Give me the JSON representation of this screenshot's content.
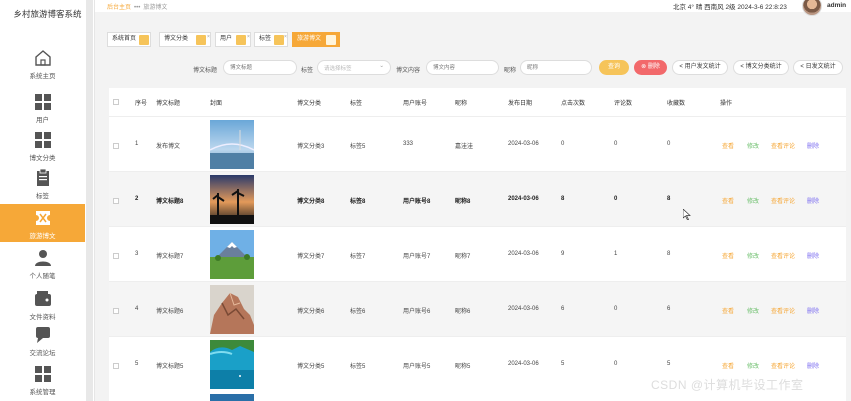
{
  "app": {
    "title": "乡村旅游博客系统"
  },
  "sidebar": {
    "items": [
      {
        "label": "系统主页",
        "icon": "home-icon"
      },
      {
        "label": "用户",
        "icon": "grid-icon"
      },
      {
        "label": "博文分类",
        "icon": "grid-icon"
      },
      {
        "label": "标签",
        "icon": "clipboard-icon"
      },
      {
        "label": "旅游博文",
        "icon": "ticket-icon",
        "active": true
      },
      {
        "label": "个人随笔",
        "icon": "person-icon"
      },
      {
        "label": "文件资料",
        "icon": "wallet-icon"
      },
      {
        "label": "交流论坛",
        "icon": "forum-icon"
      },
      {
        "label": "系统管理",
        "icon": "grid-icon"
      }
    ]
  },
  "topbar": {
    "breadcrumb": {
      "home": "后台主页",
      "sep": "•••",
      "current": "旅游博文"
    },
    "weather": "北京  4°  晴  西南风  2级  2024-3-6 22:8:23",
    "user": "admin"
  },
  "tags": [
    {
      "label": "系统首页"
    },
    {
      "label": "博文分类"
    },
    {
      "label": "用户"
    },
    {
      "label": "标签"
    },
    {
      "label": "旅游博文",
      "active": true
    }
  ],
  "search": {
    "title_label": "博文标题",
    "title_placeholder": "博文标题",
    "tag_label": "标签",
    "tag_placeholder": "请选择标签",
    "content_label": "博文内容",
    "content_placeholder": "博文内容",
    "nickname_label": "昵称",
    "nickname_placeholder": "昵称",
    "search_btn": "查询",
    "delete_btn": "删除",
    "stat1": "用户发文统计",
    "stat2": "博文分类统计",
    "stat3": "日发文统计"
  },
  "table": {
    "headers": [
      "序号",
      "博文标题",
      "封面",
      "博文分类",
      "标签",
      "用户账号",
      "昵称",
      "发布日期",
      "点击次数",
      "评论数",
      "收藏数",
      "操作"
    ],
    "actions": {
      "view": "查看",
      "edit": "修改",
      "comments": "查看评论",
      "delete": "删除"
    },
    "rows": [
      {
        "no": "1",
        "title": "发布博文",
        "category": "博文分类3",
        "tag": "标签5",
        "account": "333",
        "nickname": "嘉洼洼",
        "date": "2024-03-06",
        "clicks": "0",
        "comments": "0",
        "favs": "0",
        "img": "bridge"
      },
      {
        "no": "2",
        "title": "博文标题8",
        "category": "博文分类8",
        "tag": "标签8",
        "account": "用户账号8",
        "nickname": "昵称8",
        "date": "2024-03-06",
        "clicks": "8",
        "comments": "0",
        "favs": "8",
        "img": "sunset"
      },
      {
        "no": "3",
        "title": "博文标题7",
        "category": "博文分类7",
        "tag": "标签7",
        "account": "用户账号7",
        "nickname": "昵称7",
        "date": "2024-03-06",
        "clicks": "9",
        "comments": "1",
        "favs": "8",
        "img": "fuji"
      },
      {
        "no": "4",
        "title": "博文标题6",
        "category": "博文分类6",
        "tag": "标签6",
        "account": "用户账号6",
        "nickname": "昵称6",
        "date": "2024-03-06",
        "clicks": "6",
        "comments": "0",
        "favs": "6",
        "img": "rock"
      },
      {
        "no": "5",
        "title": "博文标题5",
        "category": "博文分类5",
        "tag": "标签5",
        "account": "用户账号5",
        "nickname": "昵称5",
        "date": "2024-03-06",
        "clicks": "5",
        "comments": "0",
        "favs": "5",
        "img": "sea"
      }
    ]
  },
  "watermark": "CSDN @计算机毕设工作室",
  "colors": {
    "accent": "#f6a838",
    "danger": "#f2696b",
    "edit": "#6cbf6c",
    "delete": "#7b6cf0"
  }
}
